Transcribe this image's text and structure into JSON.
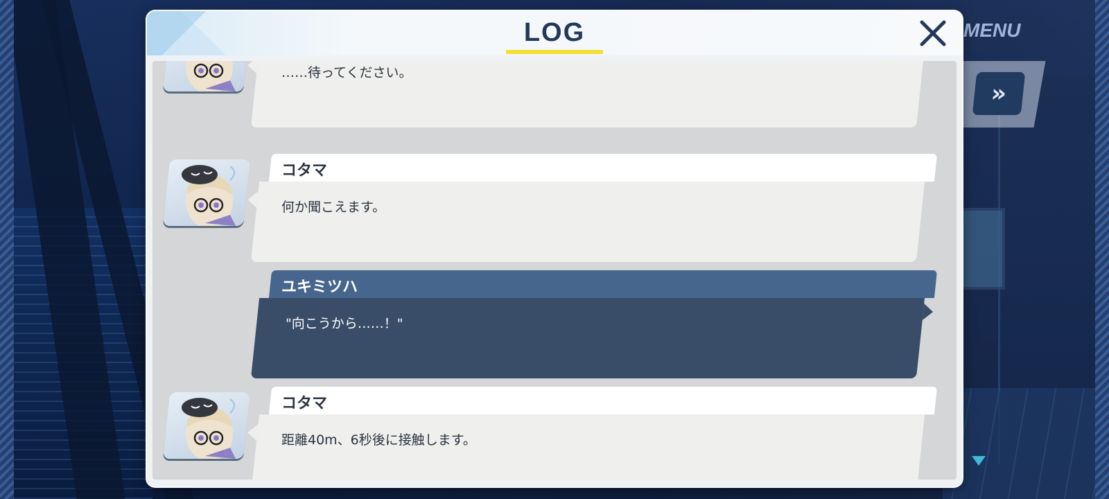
{
  "hud": {
    "menu_label": "MENU",
    "skip_label": "»"
  },
  "log_window": {
    "title": "LOG",
    "accent_color": "#f2e034",
    "close_icon": "close-x-icon"
  },
  "entries": [
    {
      "speaker": "",
      "text": "……待ってください。",
      "type": "npc",
      "avatar": "kotama-avatar"
    },
    {
      "speaker": "コタマ",
      "text": "何か聞こえます。",
      "type": "npc",
      "avatar": "kotama-avatar"
    },
    {
      "speaker": "ユキミツハ",
      "text": "\"向こうから……！\"",
      "type": "player"
    },
    {
      "speaker": "コタマ",
      "text": "距離40m、6秒後に接触します。",
      "type": "npc",
      "avatar": "kotama-avatar"
    }
  ],
  "colors": {
    "player_name_bar": "#46668e",
    "player_message_bg": "#394d69",
    "npc_message_bg": "#efefed",
    "scroll_indicator": "#3fb9d6"
  }
}
